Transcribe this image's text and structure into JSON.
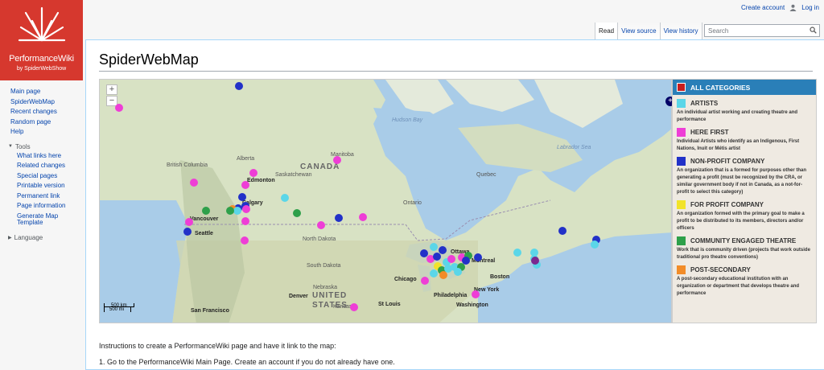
{
  "logo": {
    "name": "PerformanceWiki",
    "tagline": "by SpiderWebShow"
  },
  "personal": {
    "create_account": "Create account",
    "login": "Log in"
  },
  "sidebar": {
    "nav": [
      "Main page",
      "SpiderWebMap",
      "Recent changes",
      "Random page",
      "Help"
    ],
    "tools_heading": "Tools",
    "tools": [
      "What links here",
      "Related changes",
      "Special pages",
      "Printable version",
      "Permanent link",
      "Page information",
      "Generate Map",
      "Template"
    ],
    "language_heading": "Language"
  },
  "tabs": [
    "Read",
    "View source",
    "View history"
  ],
  "search": {
    "placeholder": "Search"
  },
  "page": {
    "title": "SpiderWebMap"
  },
  "map": {
    "zoom_in": "+",
    "zoom_out": "−",
    "labels": {
      "canada": "CANADA",
      "us1": "UNITED",
      "us2": "STATES",
      "hudson": "Hudson Bay",
      "labrador": "Labrador Sea",
      "edmonton": "Edmonton",
      "calgary": "Calgary",
      "vancouver": "Vancouver",
      "seattle": "Seattle",
      "sanfrancisco": "San Francisco",
      "chicago": "Chicago",
      "denver": "Denver",
      "stlouis": "St Louis",
      "philadelphia": "Philadelphia",
      "washington": "Washington",
      "newyork": "New York",
      "boston": "Boston",
      "montreal": "Montreal",
      "ottawa": "Ottawa",
      "quebec": "Quebec",
      "manitoba": "Manitoba",
      "saskatchewan": "Saskatchewan",
      "alberta": "Alberta",
      "british_columbia": "British Columbia",
      "ontario": "Ontario",
      "northdakota": "North Dakota",
      "southdakota": "South Dakota",
      "nebraska": "Nebraska",
      "kansas": "Kansas"
    },
    "scale_km": "500 km",
    "scale_mi": "500 mi"
  },
  "legend": {
    "all": "ALL CATEGORIES",
    "items": [
      {
        "title": "ARTISTS",
        "color": "#5bd6e8",
        "desc": "An individual artist working and creating theatre and performance"
      },
      {
        "title": "HERE FIRST",
        "color": "#ee3ed6",
        "desc": "Individual Artists who identify as an Indigenous, First Nations, Inuit or Métis artist"
      },
      {
        "title": "NON-PROFIT COMPANY",
        "color": "#2231c8",
        "desc": "An organization that is a formed for purposes other than generating a profit (must be recognized by the CRA, or similar government body if not in Canada, as a not-for-profit to select this category)"
      },
      {
        "title": "FOR PROFIT COMPANY",
        "color": "#f2e32a",
        "desc": "An organization formed with the primary goal to make a profit to be distributed to its members, directors and/or officers"
      },
      {
        "title": "COMMUNITY ENGAGED THEATRE",
        "color": "#2ea04a",
        "desc": "Work that is community driven (projects that work outside traditional pro theatre conventions)"
      },
      {
        "title": "POST-SECONDARY",
        "color": "#f28c28",
        "desc": "A post-secondary educational institution with an organization or department that develops theatre and performance"
      }
    ],
    "all_color": "#c81e1e"
  },
  "content": {
    "instructions": "Instructions to create a PerformanceWiki page and have it link to the map:",
    "step1": "1. Go to the PerformanceWiki Main Page. Create an account if you do not already have one."
  }
}
